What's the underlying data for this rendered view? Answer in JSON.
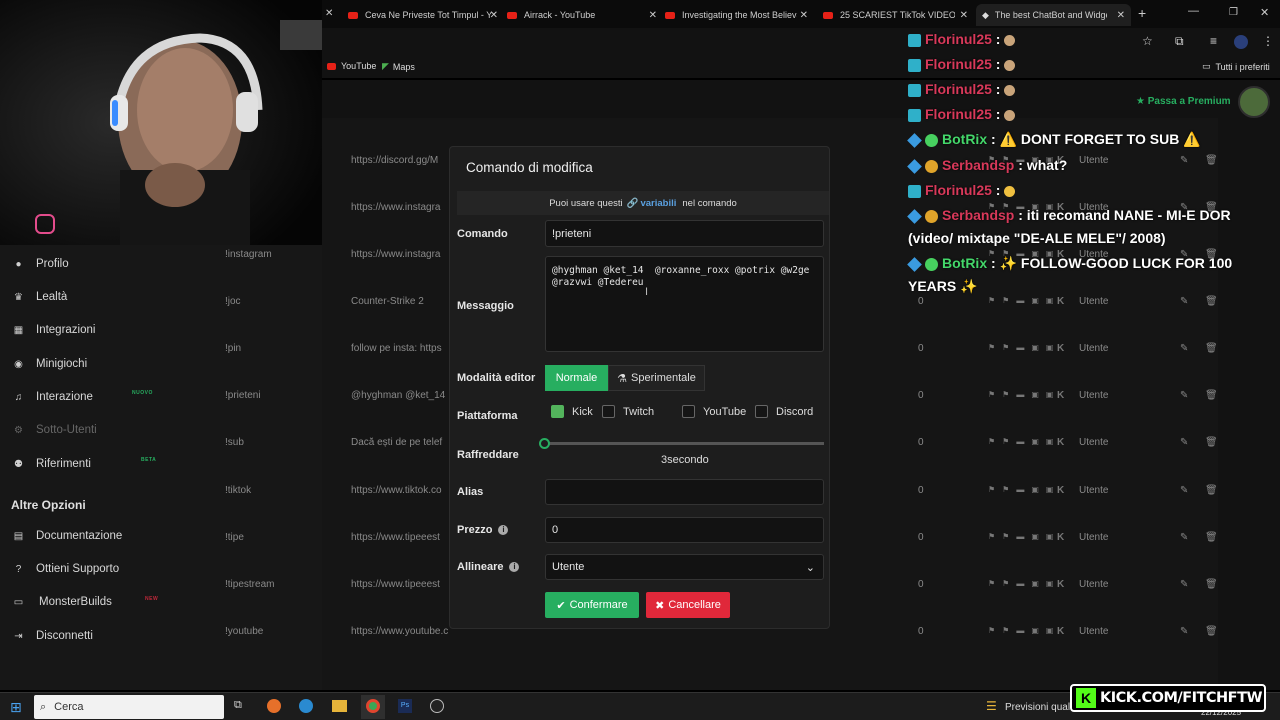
{
  "browser": {
    "tabs": [
      {
        "label": "Ceva Ne Priveste Tot Timpul - Y"
      },
      {
        "label": "Airrack - YouTube"
      },
      {
        "label": "Investigating the Most Believab"
      },
      {
        "label": "25 SCARIEST TikTok VIDEOS of"
      },
      {
        "label": "The best ChatBot and Widgets"
      }
    ],
    "bookmarks": [
      "YouTube",
      "Maps"
    ],
    "all_bookmarks": "Tutti i preferiti",
    "premium": "Passa a Premium"
  },
  "sidebar": {
    "items": [
      {
        "label": "Profilo",
        "icon": "user-icon"
      },
      {
        "label": "Lealtà",
        "icon": "trophy-icon"
      },
      {
        "label": "Integrazioni",
        "icon": "grid-icon"
      },
      {
        "label": "Minigiochi",
        "icon": "gamepad-icon"
      },
      {
        "label": "Interazione",
        "icon": "music-icon",
        "badge": "NUOVO"
      },
      {
        "label": "Sotto-Utenti",
        "icon": "gear-icon"
      },
      {
        "label": "Riferimenti",
        "icon": "people-icon",
        "badge": "BETA"
      }
    ],
    "section_title": "Altre Opzioni",
    "other": [
      {
        "label": "Documentazione",
        "icon": "doc-icon"
      },
      {
        "label": "Ottieni Supporto",
        "icon": "help-icon"
      },
      {
        "label": "MonsterBuilds",
        "icon": "monitor-icon",
        "badge": "NEW"
      },
      {
        "label": "Disconnetti",
        "icon": "logout-icon"
      }
    ]
  },
  "table": {
    "rows": [
      {
        "name": "",
        "message": "https://discord.gg/M",
        "zero": "",
        "role": "Utente"
      },
      {
        "name": "",
        "message": "https://www.instagra",
        "zero": "",
        "role": "Utente"
      },
      {
        "name": "!instagram",
        "message": "https://www.instagra",
        "zero": "",
        "role": "Utente"
      },
      {
        "name": "!joc",
        "message": "Counter-Strike 2",
        "zero": "0",
        "role": "Utente"
      },
      {
        "name": "!pin",
        "message": "follow pe insta: https",
        "zero": "0",
        "role": "Utente"
      },
      {
        "name": "!prieteni",
        "message": "@hyghman @ket_14",
        "zero": "0",
        "role": "Utente"
      },
      {
        "name": "!sub",
        "message": "Dacă ești de pe telef",
        "zero": "0",
        "role": "Utente"
      },
      {
        "name": "!tiktok",
        "message": "https://www.tiktok.co",
        "zero": "0",
        "role": "Utente"
      },
      {
        "name": "!tipe",
        "message": "https://www.tipeeest",
        "zero": "0",
        "role": "Utente"
      },
      {
        "name": "!tipestream",
        "message": "https://www.tipeeest",
        "zero": "0",
        "role": "Utente"
      },
      {
        "name": "!youtube",
        "message": "https://www.youtube.c",
        "zero": "0",
        "role": "Utente"
      }
    ]
  },
  "modal": {
    "title": "Comando di modifica",
    "hint_prefix": "Puoi usare questi",
    "hint_link": "variabili",
    "hint_suffix": "nel comando",
    "command_label": "Comando",
    "command_value": "!prieteni",
    "message_label": "Messaggio",
    "message_value": "@hyghman @ket_14  @roxanne_roxx @potrix @w2ge @razvwi @Tedereu",
    "editor_label": "Modalità editor",
    "editor_normal": "Normale",
    "editor_experimental": "Sperimentale",
    "platform_label": "Piattaforma",
    "platforms": [
      {
        "label": "Kick",
        "checked": true
      },
      {
        "label": "Twitch",
        "checked": false
      },
      {
        "label": "YouTube",
        "checked": false
      },
      {
        "label": "Discord",
        "checked": false
      }
    ],
    "cooldown_label": "Raffreddare",
    "cooldown_value": "3secondo",
    "cooldown_fraction": 0.0,
    "alias_label": "Alias",
    "alias_value": "",
    "price_label": "Prezzo",
    "price_value": "0",
    "align_label": "Allineare",
    "align_value": "Utente",
    "confirm": "Confermare",
    "cancel": "Cancellare",
    "accent": "#27ae60",
    "danger": "#e0283a"
  },
  "chat": [
    {
      "user": "Florinul25",
      "text": ":"
    },
    {
      "user": "Florinul25",
      "text": ":"
    },
    {
      "user": "Florinul25",
      "text": ":"
    },
    {
      "user": "Florinul25",
      "text": ":"
    },
    {
      "user": "BotRix",
      "text": ": ⚠️ DONT FORGET TO SUB ⚠️"
    },
    {
      "user": "Serbandsp",
      "text": ": what?"
    },
    {
      "user": "Florinul25",
      "text": ":"
    },
    {
      "user": "Serbandsp",
      "text": ": iti recomand NANE - MI-E DOR"
    },
    {
      "user": "",
      "text": "(video/ mixtape \"DE-ALE MELE\"/ 2008)"
    },
    {
      "user": "BotRix",
      "text": ": ✨ FOLLOW-GOOD LUCK FOR 100"
    },
    {
      "user": "",
      "text": "YEARS ✨"
    }
  ],
  "taskbar": {
    "search": "Cerca",
    "weather": "Previsioni quali",
    "date": "22/12/2025",
    "kick_banner": "KICK.COM/FITCHFTW"
  }
}
